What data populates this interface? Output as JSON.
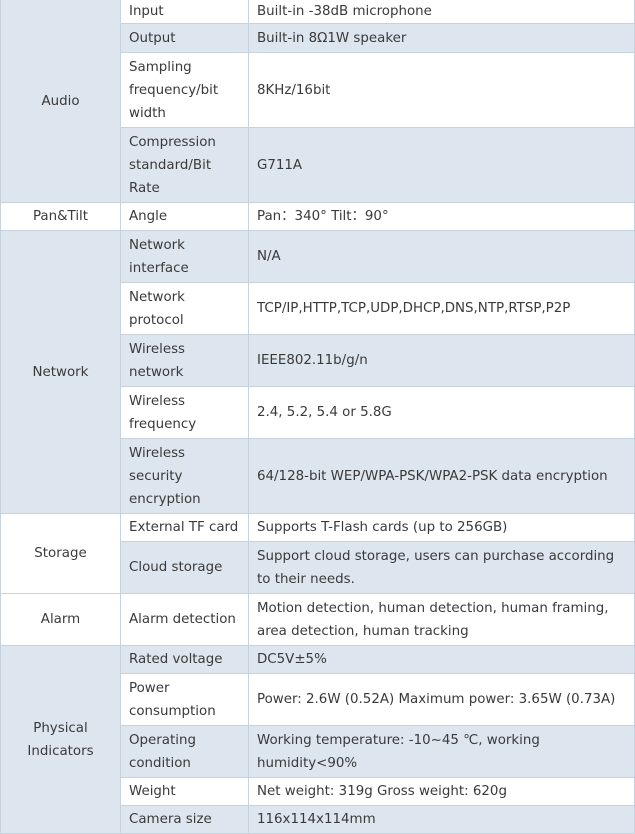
{
  "sections": [
    {
      "category": "Audio",
      "rows": [
        {
          "key": "Input",
          "value": "Built-in -38dB microphone"
        },
        {
          "key": "Output",
          "value": "Built-in 8Ω1W speaker"
        },
        {
          "key": "Sampling frequency/bit width",
          "value": "8KHz/16bit"
        },
        {
          "key": "Compression standard/Bit Rate",
          "value": "G711A"
        }
      ]
    },
    {
      "category": "Pan&Tilt",
      "rows": [
        {
          "key": "Angle",
          "value": "Pan：340° Tilt：90°"
        }
      ]
    },
    {
      "category": "Network",
      "rows": [
        {
          "key": "Network interface",
          "value": "N/A"
        },
        {
          "key": "Network protocol",
          "value": "TCP/IP,HTTP,TCP,UDP,DHCP,DNS,NTP,RTSP,P2P"
        },
        {
          "key": "Wireless network",
          "value": "IEEE802.11b/g/n"
        },
        {
          "key": "Wireless frequency",
          "value": "2.4, 5.2, 5.4 or 5.8G"
        },
        {
          "key": "Wireless security encryption",
          "value": "64/128-bit WEP/WPA-PSK/WPA2-PSK data encryption"
        }
      ]
    },
    {
      "category": "Storage",
      "rows": [
        {
          "key": "External TF card",
          "value": "Supports T-Flash cards (up to 256GB)"
        },
        {
          "key": "Cloud storage",
          "value": "Support cloud storage, users can purchase according to their needs."
        }
      ]
    },
    {
      "category": "Alarm",
      "rows": [
        {
          "key": "Alarm detection",
          "value": "Motion detection, human detection, human framing, area detection, human tracking"
        }
      ]
    },
    {
      "category": "Physical Indicators",
      "rows": [
        {
          "key": "Rated voltage",
          "value": "DC5V±5%"
        },
        {
          "key": "Power consumption",
          "value": "Power: 2.6W (0.52A) Maximum power: 3.65W (0.73A)"
        },
        {
          "key": "Operating condition",
          "value": "Working temperature: -10~45 ℃, working humidity<90%"
        },
        {
          "key": "Weight",
          "value": "Net weight: 319g Gross weight: 620g"
        },
        {
          "key": "Camera size",
          "value": "116x114x114mm"
        }
      ]
    }
  ]
}
